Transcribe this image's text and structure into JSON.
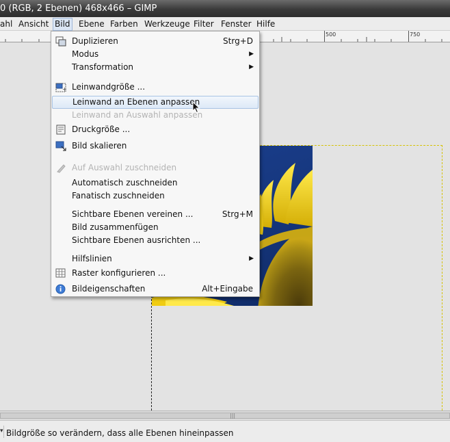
{
  "window": {
    "title": "0 (RGB, 2 Ebenen) 468x466 – GIMP"
  },
  "menubar": {
    "items": [
      "ahl",
      "Ansicht",
      "Bild",
      "Ebene",
      "Farben",
      "Werkzeuge",
      "Filter",
      "Fenster",
      "Hilfe"
    ]
  },
  "ruler": {
    "labels": [
      "500",
      "750"
    ]
  },
  "menu": {
    "items": [
      {
        "label": "Duplizieren",
        "shortcut": "Strg+D",
        "icon": "duplicate-icon",
        "disabled": false
      },
      {
        "label": "Modus",
        "submenu": true,
        "disabled": false
      },
      {
        "label": "Transformation",
        "submenu": true,
        "disabled": false
      },
      {
        "label": "Leinwandgröße ...",
        "icon": "canvas-size-icon",
        "disabled": false
      },
      {
        "label": "Leinwand an Ebenen anpassen",
        "disabled": false,
        "highlighted": true
      },
      {
        "label": "Leinwand an Auswahl anpassen",
        "disabled": true
      },
      {
        "label": "Druckgröße ...",
        "icon": "print-size-icon",
        "disabled": false
      },
      {
        "label": "Bild skalieren",
        "icon": "scale-image-icon",
        "disabled": false
      },
      {
        "label": "Auf Auswahl zuschneiden",
        "icon": "crop-icon",
        "disabled": true
      },
      {
        "label": "Automatisch zuschneiden",
        "disabled": false
      },
      {
        "label": "Fanatisch zuschneiden",
        "disabled": false
      },
      {
        "label": "Sichtbare Ebenen vereinen ...",
        "shortcut": "Strg+M",
        "disabled": false
      },
      {
        "label": "Bild zusammenfügen",
        "disabled": false
      },
      {
        "label": "Sichtbare Ebenen ausrichten ...",
        "disabled": false
      },
      {
        "label": "Hilfslinien",
        "submenu": true,
        "disabled": false
      },
      {
        "label": "Raster konfigurieren ...",
        "icon": "grid-icon",
        "disabled": false
      },
      {
        "label": "Bildeigenschaften",
        "shortcut": "Alt+Eingabe",
        "icon": "info-icon",
        "disabled": false
      }
    ]
  },
  "statusbar": {
    "text": "Bildgröße so verändern, dass alle Ebenen hineinpassen"
  },
  "colors": {
    "highlight": "#dde9f7",
    "photo_sky": "#16377e",
    "petal": "#f2d20a"
  }
}
